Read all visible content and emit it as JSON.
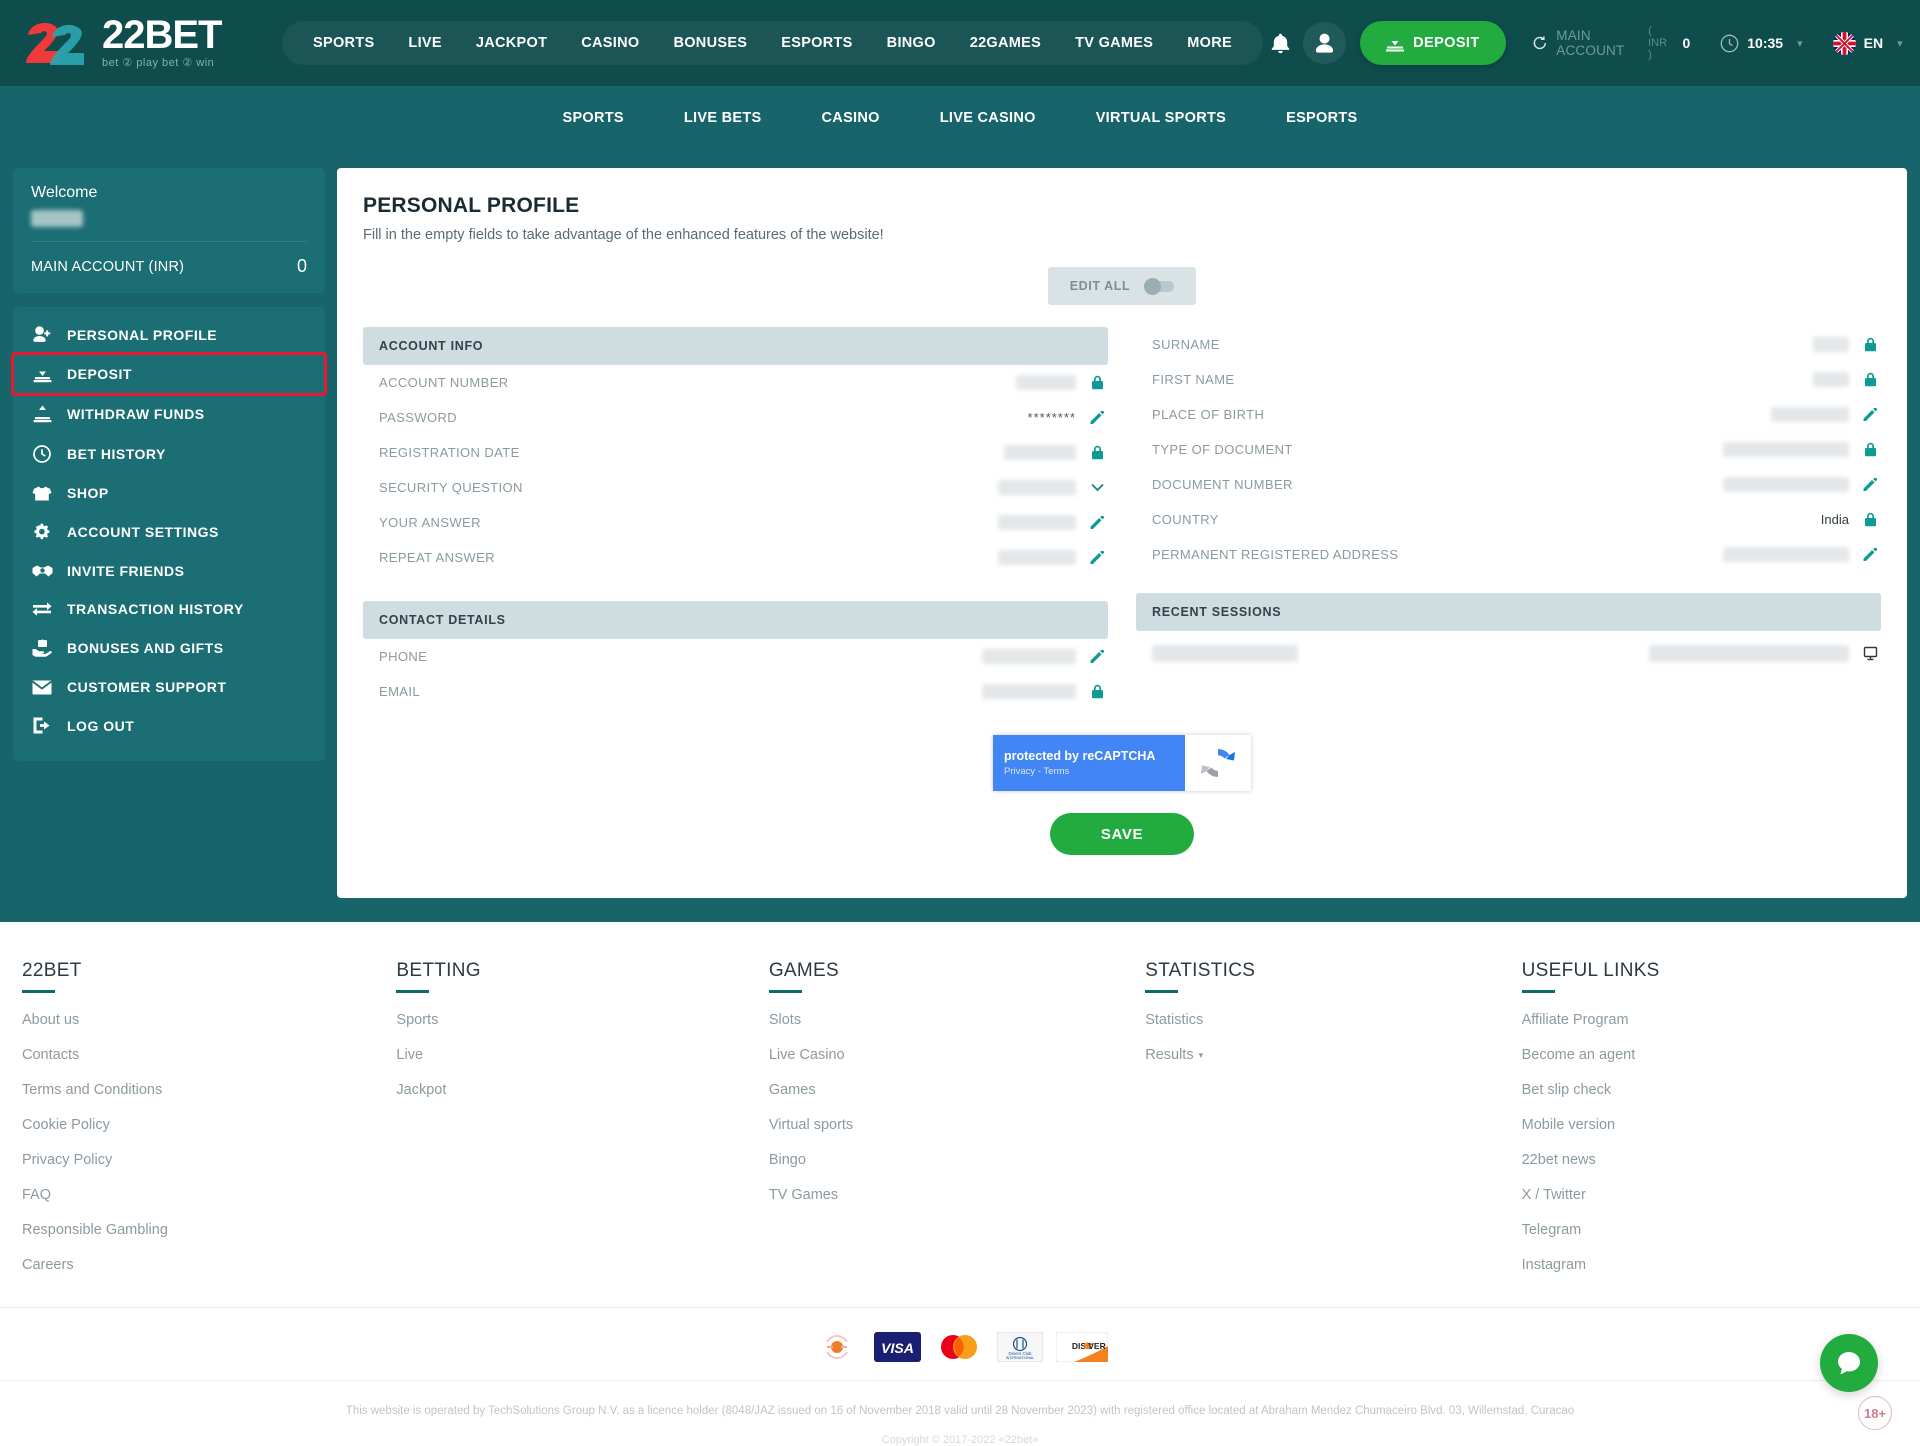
{
  "brand": {
    "name": "22BET",
    "tagline": "bet ② play   bet ② win",
    "logo_red": "#ee3a3a",
    "logo_teal": "#2aa5ae"
  },
  "header": {
    "nav": [
      {
        "label": "SPORTS"
      },
      {
        "label": "LIVE"
      },
      {
        "label": "JACKPOT"
      },
      {
        "label": "CASINO"
      },
      {
        "label": "BONUSES"
      },
      {
        "label": "ESPORTS"
      },
      {
        "label": "BINGO"
      },
      {
        "label": "22GAMES"
      },
      {
        "label": "TV GAMES"
      },
      {
        "label": "MORE"
      }
    ],
    "notifications_icon": "bell-icon",
    "profile_icon": "user-icon",
    "deposit_label": "DEPOSIT",
    "account_label": "MAIN ACCOUNT",
    "account_currency": "( INR )",
    "account_balance": "0",
    "time": "10:35",
    "language": "EN",
    "accent_green": "#22ac3f",
    "header_bg": "#0f4c4c"
  },
  "subnav": [
    {
      "label": "SPORTS"
    },
    {
      "label": "LIVE BETS"
    },
    {
      "label": "CASINO"
    },
    {
      "label": "LIVE CASINO"
    },
    {
      "label": "VIRTUAL SPORTS"
    },
    {
      "label": "ESPORTS"
    }
  ],
  "sidebar": {
    "welcome_label": "Welcome",
    "account_name": "MAIN ACCOUNT (INR)",
    "account_value": "0",
    "items": [
      {
        "label": "PERSONAL PROFILE",
        "icon": "user-add-icon",
        "highlighted": false
      },
      {
        "label": "DEPOSIT",
        "icon": "deposit-icon",
        "highlighted": true
      },
      {
        "label": "WITHDRAW FUNDS",
        "icon": "withdraw-icon",
        "highlighted": false
      },
      {
        "label": "BET HISTORY",
        "icon": "clock-icon",
        "highlighted": false
      },
      {
        "label": "SHOP",
        "icon": "shirt-icon",
        "highlighted": false
      },
      {
        "label": "ACCOUNT SETTINGS",
        "icon": "gears-icon",
        "highlighted": false
      },
      {
        "label": "INVITE FRIENDS",
        "icon": "handshake-icon",
        "highlighted": false
      },
      {
        "label": "TRANSACTION HISTORY",
        "icon": "transfer-icon",
        "highlighted": false
      },
      {
        "label": "BONUSES AND GIFTS",
        "icon": "gift-hand-icon",
        "highlighted": false
      },
      {
        "label": "CUSTOMER SUPPORT",
        "icon": "envelope-icon",
        "highlighted": false
      },
      {
        "label": "LOG OUT",
        "icon": "logout-icon",
        "highlighted": false
      }
    ],
    "highlight_color": "#e8192c"
  },
  "main": {
    "title": "PERSONAL PROFILE",
    "subtitle": "Fill in the empty fields to take advantage of the enhanced features of the website!",
    "edit_all_label": "EDIT ALL",
    "sections": {
      "account_info": {
        "header": "ACCOUNT INFO",
        "fields": [
          {
            "label": "ACCOUNT NUMBER",
            "value": "",
            "redacted": true,
            "redact_w": 60,
            "action": "lock"
          },
          {
            "label": "PASSWORD",
            "value": "********",
            "redacted": false,
            "action": "edit"
          },
          {
            "label": "REGISTRATION DATE",
            "value": "",
            "redacted": true,
            "redact_w": 72,
            "action": "lock"
          },
          {
            "label": "SECURITY QUESTION",
            "value": "",
            "redacted": true,
            "redact_w": 78,
            "action": "chevron"
          },
          {
            "label": "YOUR ANSWER",
            "value": "",
            "redacted": true,
            "redact_w": 78,
            "action": "edit"
          },
          {
            "label": "REPEAT ANSWER",
            "value": "",
            "redacted": true,
            "redact_w": 78,
            "action": "edit"
          }
        ]
      },
      "personal_data": {
        "header": "",
        "fields": [
          {
            "label": "SURNAME",
            "value": "",
            "redacted": true,
            "redact_w": 36,
            "action": "lock"
          },
          {
            "label": "FIRST NAME",
            "value": "",
            "redacted": true,
            "redact_w": 36,
            "action": "lock"
          },
          {
            "label": "PLACE OF BIRTH",
            "value": "",
            "redacted": true,
            "redact_w": 78,
            "action": "edit"
          },
          {
            "label": "TYPE OF DOCUMENT",
            "value": "",
            "redacted": true,
            "redact_w": 126,
            "action": "lock"
          },
          {
            "label": "DOCUMENT NUMBER",
            "value": "",
            "redacted": true,
            "redact_w": 126,
            "action": "edit"
          },
          {
            "label": "COUNTRY",
            "value": "India",
            "redacted": false,
            "action": "lock"
          },
          {
            "label": "PERMANENT REGISTERED ADDRESS",
            "value": "",
            "redacted": true,
            "redact_w": 126,
            "action": "edit"
          }
        ]
      },
      "contact_details": {
        "header": "CONTACT DETAILS",
        "fields": [
          {
            "label": "PHONE",
            "value": "",
            "redacted": true,
            "redact_w": 94,
            "action": "edit"
          },
          {
            "label": "EMAIL",
            "value": "",
            "redacted": true,
            "redact_w": 94,
            "action": "lock"
          }
        ]
      },
      "recent_sessions": {
        "header": "RECENT SESSIONS",
        "rows": [
          {
            "col1": "",
            "col2": "",
            "icon": "monitor-icon",
            "redacted": true
          }
        ]
      }
    },
    "captcha": {
      "title": "protected by reCAPTCHA",
      "links": "Privacy - Terms",
      "brand_blue": "#4285f4"
    },
    "save_label": "SAVE"
  },
  "footer": {
    "columns": [
      {
        "heading": "22BET",
        "links": [
          {
            "label": "About us"
          },
          {
            "label": "Contacts"
          },
          {
            "label": "Terms and Conditions"
          },
          {
            "label": "Cookie Policy"
          },
          {
            "label": "Privacy Policy"
          },
          {
            "label": "FAQ"
          },
          {
            "label": "Responsible Gambling"
          },
          {
            "label": "Careers"
          }
        ]
      },
      {
        "heading": "BETTING",
        "links": [
          {
            "label": "Sports"
          },
          {
            "label": "Live"
          },
          {
            "label": "Jackpot"
          }
        ]
      },
      {
        "heading": "GAMES",
        "links": [
          {
            "label": "Slots"
          },
          {
            "label": "Live Casino"
          },
          {
            "label": "Games"
          },
          {
            "label": "Virtual sports"
          },
          {
            "label": "Bingo"
          },
          {
            "label": "TV Games"
          }
        ]
      },
      {
        "heading": "STATISTICS",
        "links": [
          {
            "label": "Statistics"
          },
          {
            "label": "Results",
            "caret": true
          }
        ]
      },
      {
        "heading": "USEFUL LINKS",
        "links": [
          {
            "label": "Affiliate Program"
          },
          {
            "label": "Become an agent"
          },
          {
            "label": "Bet slip check"
          },
          {
            "label": "Mobile version"
          },
          {
            "label": "22bet news"
          },
          {
            "label": "X / Twitter"
          },
          {
            "label": "Telegram"
          },
          {
            "label": "Instagram"
          }
        ]
      }
    ],
    "payments": [
      "paysafe-icon",
      "visa-icon",
      "mastercard-icon",
      "diners-club-icon",
      "discover-icon"
    ],
    "legal": "This website is operated by TechSolutions Group N.V. as a licence holder (8048/JAZ issued on 16 of November 2018 valid until 28 November 2023) with registered office located at Abraham Mendez Chumaceiro Blvd. 03, Willemstad, Curacao",
    "copyright": "Copyright © 2017-2022 «22bet»",
    "age_badge": "18+"
  }
}
